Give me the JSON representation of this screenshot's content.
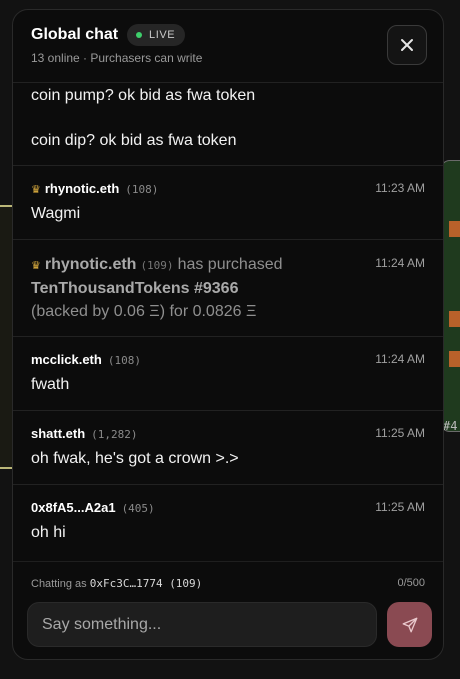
{
  "header": {
    "title": "Global chat",
    "live_label": "LIVE",
    "subtitle": "13 online · Purchasers can write",
    "close_icon": "close-icon"
  },
  "background": {
    "right_card_tag": "#4"
  },
  "messages": [
    {
      "type": "partial",
      "lines": [
        "coin pump? ok bid as fwa token",
        "coin dip? ok bid as fwa token"
      ]
    },
    {
      "type": "chat",
      "crown": true,
      "author": "rhynotic.eth",
      "count": "(108)",
      "time": "11:23 AM",
      "body": "Wagmi"
    },
    {
      "type": "purchase",
      "crown": true,
      "author": "rhynotic.eth",
      "count": "(109)",
      "action": "has purchased",
      "token": "TenThousandTokens #9366",
      "detail": "(backed by 0.06 Ξ) for 0.0826 Ξ",
      "time": "11:24 AM"
    },
    {
      "type": "chat",
      "author": "mcclick.eth",
      "count": "(108)",
      "time": "11:24 AM",
      "body": "fwath"
    },
    {
      "type": "chat",
      "author": "shatt.eth",
      "count": "(1,282)",
      "time": "11:25 AM",
      "body": "oh fwak, he's got a crown >.>"
    },
    {
      "type": "chat",
      "author": "0x8fA5...A2a1",
      "count": "(405)",
      "time": "11:25 AM",
      "body": "oh hi"
    }
  ],
  "footer": {
    "chatting_as_prefix": "Chatting as",
    "chatting_as_address": "0xFc3C…1774 (109)",
    "char_count": "0/500",
    "input_placeholder": "Say something...",
    "input_value": "",
    "send_icon": "send-icon"
  },
  "colors": {
    "live_dot": "#3ecf6b",
    "crown": "#e3b341",
    "send_button": "#8a4a52"
  }
}
